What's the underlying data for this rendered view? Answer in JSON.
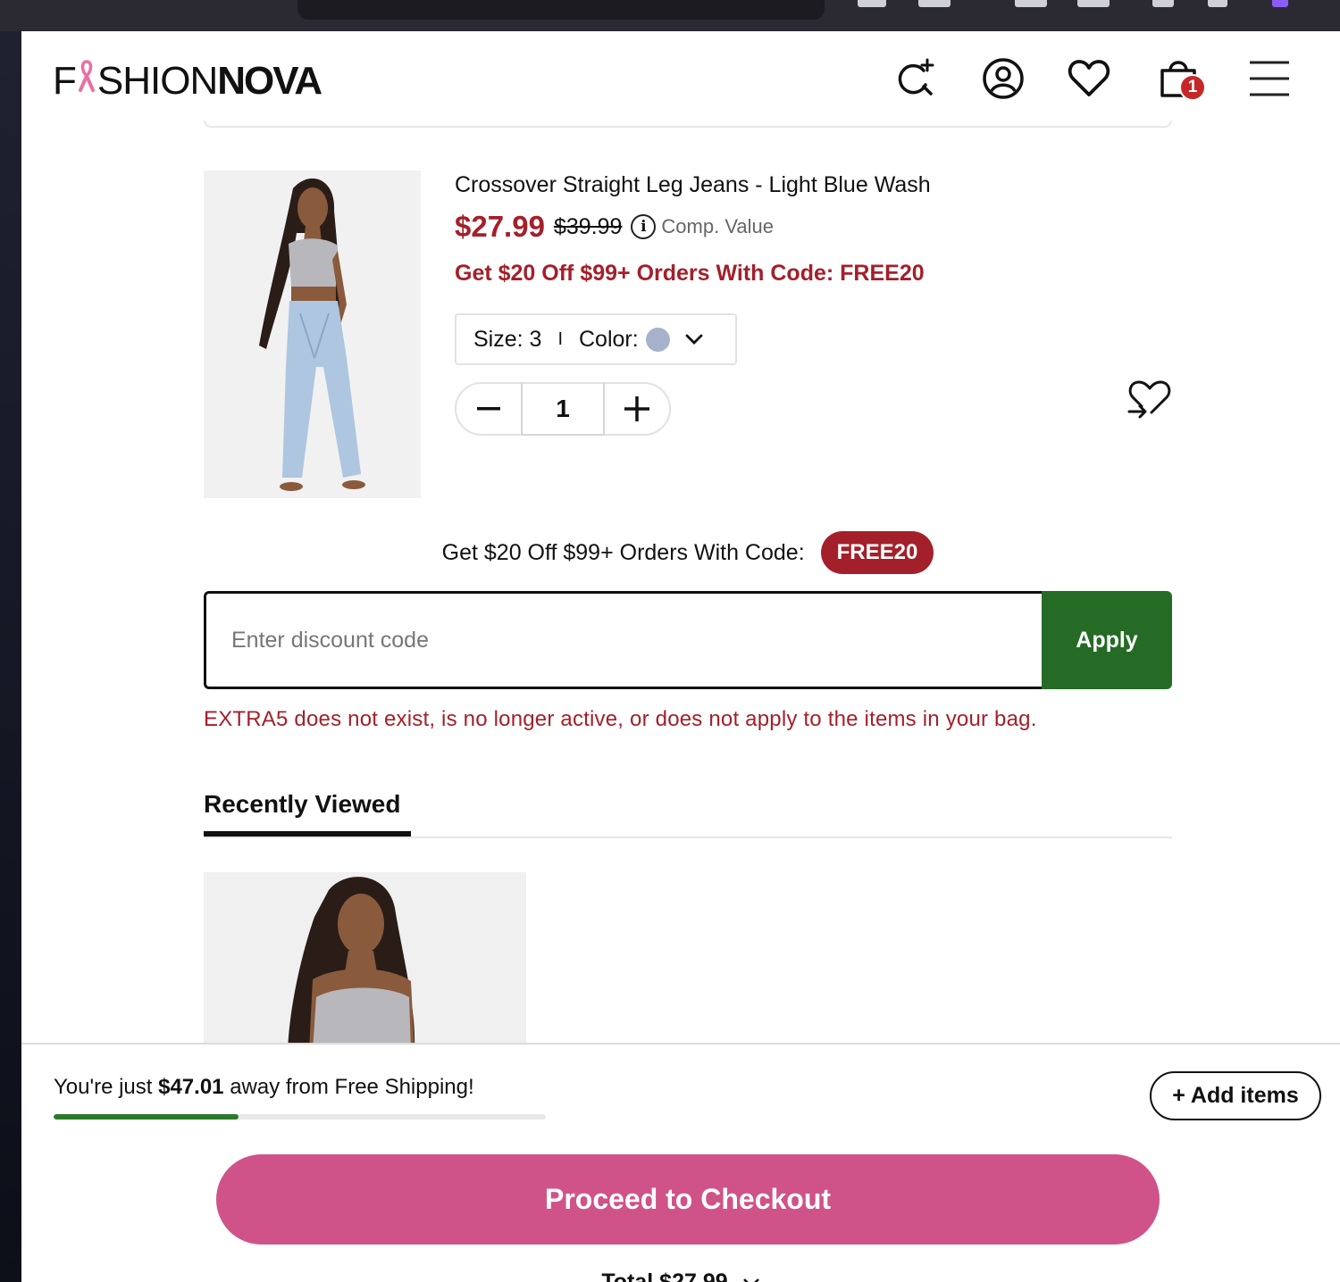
{
  "brand": {
    "part1": "F",
    "part2": "SHION",
    "part3": "NOVA",
    "ribbon_color": "#e96fa2"
  },
  "header": {
    "cart_count": "1"
  },
  "product": {
    "name": "Crossover Straight Leg Jeans - Light Blue Wash",
    "price": "$27.99",
    "original_price": "$39.99",
    "info_glyph": "i",
    "comp_value": "Comp. Value",
    "promo": "Get $20 Off $99+ Orders With Code: FREE20",
    "size_label": "Size: 3",
    "separator": "I",
    "color_label": "Color:",
    "color_swatch": "#a6b2c9",
    "quantity": "1"
  },
  "discount": {
    "promo_text": "Get $20 Off $99+ Orders With Code:",
    "promo_code": "FREE20",
    "placeholder": "Enter discount code",
    "apply_label": "Apply",
    "error": "EXTRA5 does not exist, is no longer active, or does not apply to the items in your bag."
  },
  "recently_viewed": {
    "tab_label": "Recently Viewed"
  },
  "footer": {
    "ship_prefix": "You're just",
    "ship_amount": "$47.01",
    "ship_suffix": "away from Free Shipping!",
    "ship_progress_pct": 37.5,
    "add_items_label": "+ Add items",
    "checkout_label": "Proceed to Checkout",
    "total_label": "Total $27.99"
  },
  "colors": {
    "sale_red": "#a3202b",
    "apply_green": "#256b25",
    "checkout_pink": "#cf5388",
    "progress_green": "#2b7a2b"
  }
}
